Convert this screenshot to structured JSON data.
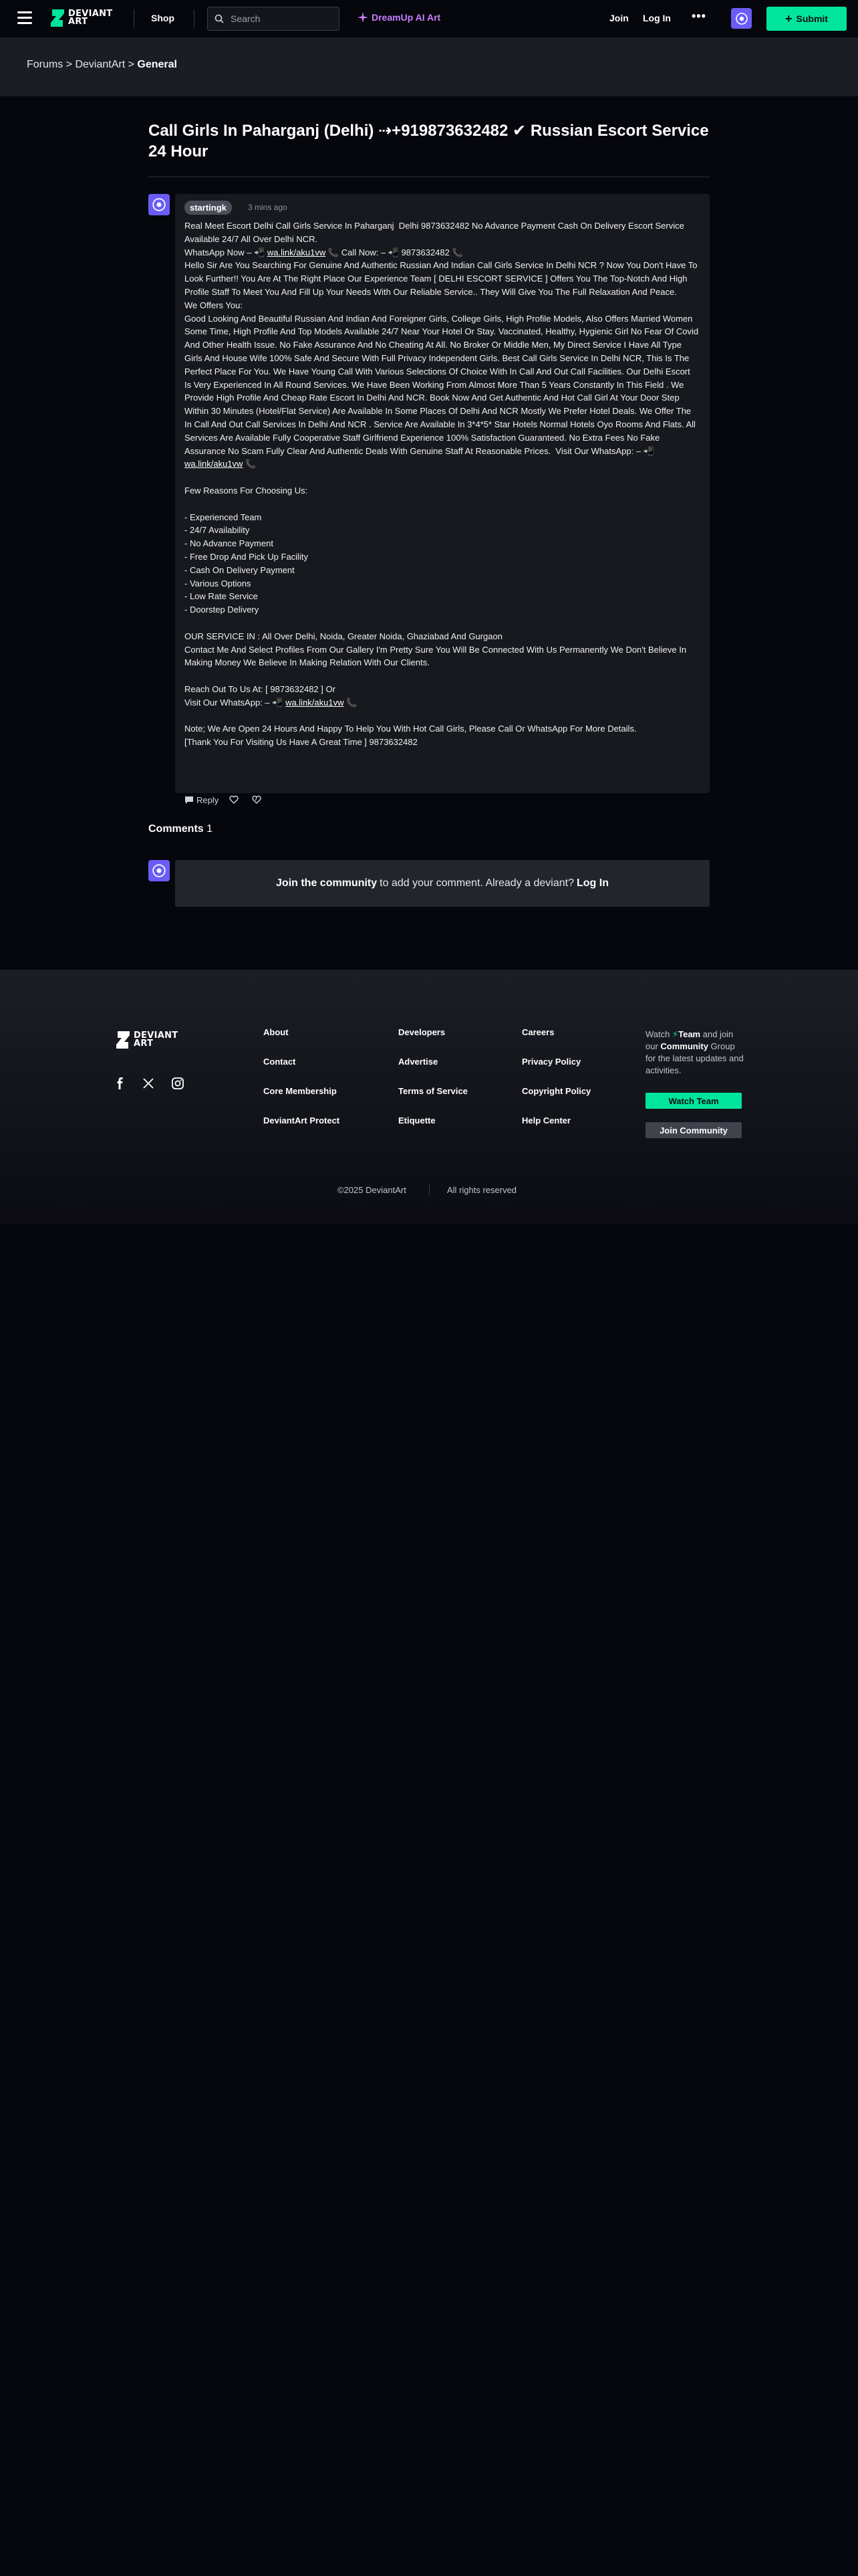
{
  "header": {
    "logo_text_line1": "DEVIANT",
    "logo_text_line2": "ART",
    "shop_label": "Shop",
    "search_placeholder": "Search",
    "dreamup_label": "DreamUp AI Art",
    "join_label": "Join",
    "login_label": "Log In",
    "more_label": "•••",
    "submit_label": "Submit"
  },
  "breadcrumb": {
    "item1": "Forums",
    "sep1": " > ",
    "item2": "DeviantArt",
    "sep2": " > ",
    "current": "General"
  },
  "post": {
    "title": "Call Girls In Paharganj (Delhi) ⇢+919873632482 ✔ Russian Escort Service 24 Hour",
    "author": "startingk",
    "time": "3 mins ago",
    "p1": "Real Meet Escort Delhi Call Girls Service In Paharganj  Delhi 9873632482 No Advance Payment Cash On Delivery Escort Service Available 24/7 All Over Delhi NCR.",
    "wa_prefix": "WhatsApp Now – 📲 ",
    "wa_link": "wa.link/aku1vw",
    "wa_mid": " 📞 Call Now: – 📲 9873632482 📞",
    "p2": "Hello Sir Are You Searching For Genuine And Authentic Russian And Indian Call Girls Service In Delhi NCR ? Now You Don't Have To Look Further!! You Are At The Right Place Our Experience Team [ DELHI ESCORT SERVICE ] Offers You The Top-Notch And High Profile Staff To Meet You And Fill Up Your Needs With Our Reliable Service.. They Will Give You The Full Relaxation And Peace.",
    "p3_heading": "We Offers You:",
    "p3": "Good Looking And Beautiful Russian And Indian And Foreigner Girls, College Girls, High Profile Models, Also Offers Married Women Some Time, High Profile And Top Models Available 24/7 Near Your Hotel Or Stay. Vaccinated, Healthy, Hygienic Girl No Fear Of Covid And Other Health Issue. No Fake Assurance And No Cheating At All. No Broker Or Middle Men, My Direct Service I Have All Type Girls And House Wife 100% Safe And Secure With Full Privacy Independent Girls. Best Call Girls Service In Delhi NCR, This Is The Perfect Place For You. We Have Young Call With Various Selections Of Choice With In Call And Out Call Facilities. Our Delhi Escort Is Very Experienced In All Round Services. We Have Been Working From Almost More Than 5 Years Constantly In This Field . We Provide High Profile And Cheap Rate Escort In Delhi And NCR. Book Now And Get Authentic And Hot Call Girl At Your Door Step Within 30 Minutes (Hotel/Flat Service) Are Available In Some Places Of Delhi And NCR Mostly We Prefer Hotel Deals. We Offer The In Call And Out Call Services In Delhi And NCR . Service Are Available In 3*4*5* Star Hotels Normal Hotels Oyo Rooms And Flats. All Services Are Available Fully Cooperative Staff Girlfriend Experience 100% Satisfaction Guaranteed. No Extra Fees No Fake Assurance No Scam Fully Clear And Authentic Deals With Genuine Staff At Reasonable Prices.  Visit Our WhatsApp: – 📲 ",
    "p3_link": "wa.link/aku1vw",
    "p3_end": " 📞",
    "reasons_heading": "Few Reasons For Choosing Us:",
    "reasons": [
      "- Experienced Team",
      "- 24/7 Availability",
      "- No Advance Payment",
      "- Free Drop And Pick Up Facility",
      "- Cash On Delivery Payment",
      "- Various Options",
      "- Low Rate Service",
      "- Doorstep Delivery"
    ],
    "service_in": "OUR SERVICE IN : All Over Delhi, Noida, Greater Noida, Ghaziabad And Gurgaon",
    "contact": "Contact Me And Select Profiles From Our Gallery I'm Pretty Sure You Will Be Connected With Us Permanently We Don't Believe In Making Money We Believe In Making Relation With Our Clients.",
    "reach": "Reach Out To Us At: [ 9873632482 ] Or",
    "visit_prefix": "Visit Our WhatsApp: – 📲 ",
    "visit_link": "wa.link/aku1vw",
    "visit_end": " 📞",
    "note": "Note; We Are Open 24 Hours And Happy To Help You With Hot Call Girls, Please Call Or WhatsApp For More Details.",
    "thanks": "[Thank You For Visiting Us Have A Great Time ] 9873632482",
    "reply_label": "Reply"
  },
  "comments": {
    "heading": "Comments",
    "count": "1",
    "join_bold": "Join the community",
    "join_text": "to add your comment. Already a deviant?",
    "login_label": "Log In"
  },
  "footer": {
    "col1": [
      "About",
      "Contact",
      "Core Membership",
      "DeviantArt Protect"
    ],
    "col2": [
      "Developers",
      "Advertise",
      "Terms of Service",
      "Etiquette"
    ],
    "col3": [
      "Careers",
      "Privacy Policy",
      "Copyright Policy",
      "Help Center"
    ],
    "watch_pre": "Watch",
    "team_label": "Team",
    "watch_and": "and join our",
    "community_label": "Community",
    "watch_post": "Group for the latest updates and activities.",
    "watch_team_button": "Watch Team",
    "join_community_button": "Join Community",
    "copyright": "©2025 DeviantArt",
    "rights": "All rights reserved"
  },
  "colors": {
    "accent_green": "#00e59b",
    "dreamup_purple": "#c87cff",
    "avatar_purple": "#6b5cf7",
    "background": "#06070d"
  },
  "icons": [
    "menu-icon",
    "deviantart-logo-icon",
    "search-icon",
    "dreamup-sparkle-icon",
    "avatar-icon",
    "plus-icon",
    "reply-icon",
    "heart-icon",
    "heart-outline-icon",
    "facebook-icon",
    "x-icon",
    "instagram-icon"
  ]
}
